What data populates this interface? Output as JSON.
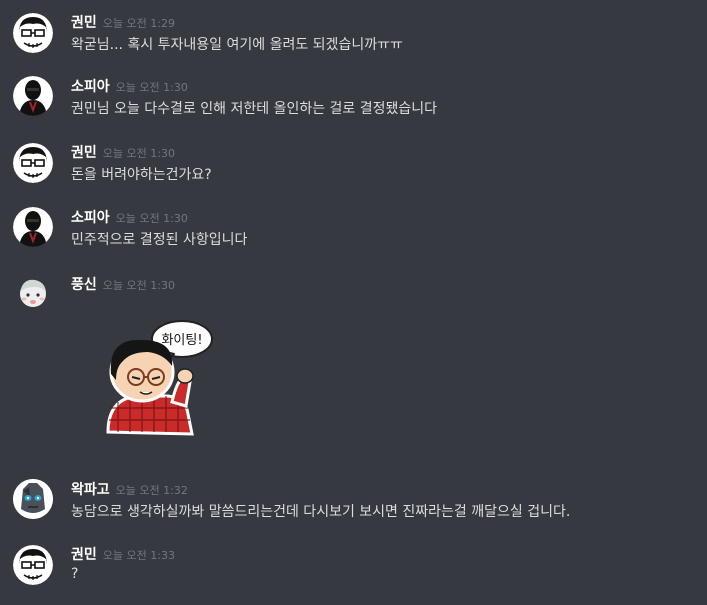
{
  "messages": [
    {
      "author": "권민",
      "time": "오늘 오전 1:29",
      "text": "왁굳님... 혹시 투자내용일 여기에 올려도 되겠습니까ㅠㅠ"
    },
    {
      "author": "소피아",
      "time": "오늘 오전 1:30",
      "text": "권민님 오늘 다수결로 인해 저한테 올인하는 걸로 결정됐습니다"
    },
    {
      "author": "권민",
      "time": "오늘 오전 1:30",
      "text": "돈을 버려야하는건가요?"
    },
    {
      "author": "소피아",
      "time": "오늘 오전 1:30",
      "text": "민주적으로 결정된 사항입니다"
    },
    {
      "author": "풍신",
      "time": "오늘 오전 1:30",
      "sticker_text": "화이팅!"
    },
    {
      "author": "왁파고",
      "time": "오늘 오전 1:32",
      "text": "농담으로 생각하실까봐 말씀드리는건데 다시보기 보시면 진짜라는걸 깨달으실 겁니다."
    },
    {
      "author": "권민",
      "time": "오늘 오전 1:33",
      "text": "?"
    }
  ],
  "colors": {
    "background": "#36393f",
    "username": "#ffffff",
    "timestamp": "#72767d",
    "text": "#dcddde"
  }
}
